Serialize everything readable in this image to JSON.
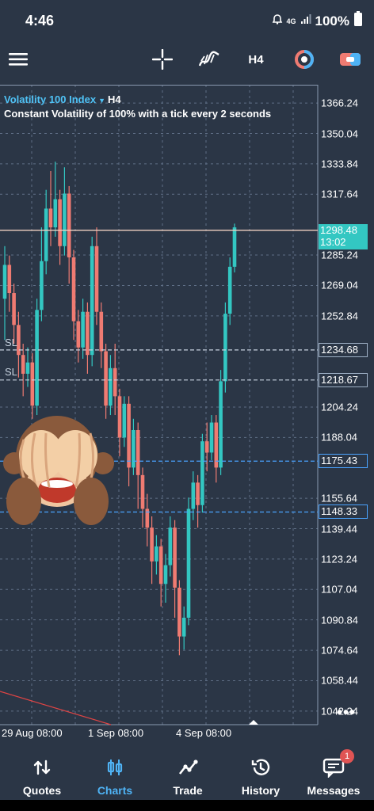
{
  "status": {
    "time": "4:46",
    "network": "4G",
    "battery": "100%"
  },
  "toolbar": {
    "timeframe": "H4"
  },
  "chart": {
    "symbol": "Volatility 100 Index",
    "timeframe": "H4",
    "description": "Constant Volatility of 100% with a tick every 2 seconds",
    "y_ticks": [
      "1366.24",
      "1350.04",
      "1333.84",
      "1317.64",
      "1285.24",
      "1269.04",
      "1252.84",
      "1204.24",
      "1188.04",
      "1155.64",
      "1139.44",
      "1123.24",
      "1107.04",
      "1090.84",
      "1074.64",
      "1058.44",
      "1042.24"
    ],
    "current_price": "1298.48",
    "countdown": "13:02",
    "sl_tags": [
      "1234.68",
      "1218.67"
    ],
    "sl_label": "SL",
    "order_tags": [
      "1175.43",
      "1148.33"
    ],
    "x_ticks": [
      "29 Aug 08:00",
      "1 Sep 08:00",
      "4 Sep 08:00"
    ],
    "more": "•••",
    "colors": {
      "bull": "#33c7c2",
      "bear": "#ef7b72",
      "background": "#2b3646",
      "grid": "#5f6f86"
    }
  },
  "chart_data": {
    "type": "candlestick",
    "x": [
      "29 Aug 08:00",
      "1 Sep 08:00",
      "4 Sep 08:00"
    ],
    "ylim": [
      1035,
      1376
    ],
    "candles": [
      [
        1262,
        1280,
        1240,
        1290
      ],
      [
        1280,
        1265,
        1255,
        1285
      ],
      [
        1265,
        1248,
        1238,
        1270
      ],
      [
        1248,
        1232,
        1220,
        1255
      ],
      [
        1232,
        1222,
        1210,
        1238
      ],
      [
        1222,
        1228,
        1215,
        1236
      ],
      [
        1228,
        1205,
        1198,
        1233
      ],
      [
        1205,
        1256,
        1200,
        1262
      ],
      [
        1256,
        1282,
        1250,
        1300
      ],
      [
        1282,
        1310,
        1275,
        1320
      ],
      [
        1310,
        1300,
        1290,
        1330
      ],
      [
        1300,
        1315,
        1295,
        1335
      ],
      [
        1315,
        1290,
        1280,
        1320
      ],
      [
        1290,
        1318,
        1285,
        1332
      ],
      [
        1318,
        1284,
        1270,
        1322
      ],
      [
        1284,
        1250,
        1240,
        1288
      ],
      [
        1250,
        1236,
        1228,
        1256
      ],
      [
        1236,
        1255,
        1230,
        1262
      ],
      [
        1255,
        1232,
        1222,
        1260
      ],
      [
        1232,
        1290,
        1226,
        1295
      ],
      [
        1290,
        1255,
        1248,
        1300
      ],
      [
        1255,
        1234,
        1225,
        1260
      ],
      [
        1234,
        1205,
        1198,
        1238
      ],
      [
        1205,
        1225,
        1200,
        1232
      ],
      [
        1225,
        1210,
        1200,
        1238
      ],
      [
        1210,
        1188,
        1178,
        1214
      ],
      [
        1188,
        1206,
        1183,
        1210
      ],
      [
        1206,
        1172,
        1162,
        1210
      ],
      [
        1172,
        1192,
        1168,
        1198
      ],
      [
        1192,
        1168,
        1150,
        1196
      ],
      [
        1168,
        1150,
        1140,
        1172
      ],
      [
        1150,
        1140,
        1130,
        1158
      ],
      [
        1140,
        1122,
        1110,
        1146
      ],
      [
        1122,
        1130,
        1115,
        1136
      ],
      [
        1130,
        1110,
        1098,
        1134
      ],
      [
        1110,
        1120,
        1100,
        1126
      ],
      [
        1120,
        1140,
        1114,
        1146
      ],
      [
        1140,
        1108,
        1092,
        1144
      ],
      [
        1108,
        1082,
        1072,
        1112
      ],
      [
        1082,
        1092,
        1075,
        1098
      ],
      [
        1092,
        1150,
        1088,
        1156
      ],
      [
        1150,
        1164,
        1144,
        1170
      ],
      [
        1164,
        1152,
        1140,
        1168
      ],
      [
        1152,
        1186,
        1148,
        1190
      ],
      [
        1186,
        1180,
        1170,
        1196
      ],
      [
        1180,
        1196,
        1176,
        1200
      ],
      [
        1196,
        1172,
        1164,
        1200
      ],
      [
        1172,
        1218,
        1168,
        1224
      ],
      [
        1218,
        1254,
        1212,
        1260
      ],
      [
        1254,
        1279,
        1248,
        1284
      ],
      [
        1279,
        1300,
        1276,
        1302
      ]
    ],
    "current_price": 1298.48,
    "horizontal_lines": [
      {
        "price": 1298.48,
        "style": "solid",
        "color": "#f0d0c0"
      },
      {
        "price": 1234.68,
        "style": "dashed",
        "color": "#c8d3e0"
      },
      {
        "price": 1218.67,
        "style": "dashed",
        "color": "#c8d3e0"
      },
      {
        "price": 1175.43,
        "style": "dashed",
        "color": "#4aa3ff"
      },
      {
        "price": 1148.33,
        "style": "dashed",
        "color": "#4aa3ff"
      }
    ]
  },
  "nav": {
    "items": [
      {
        "label": "Quotes"
      },
      {
        "label": "Charts"
      },
      {
        "label": "Trade"
      },
      {
        "label": "History"
      },
      {
        "label": "Messages",
        "badge": "1"
      }
    ]
  }
}
